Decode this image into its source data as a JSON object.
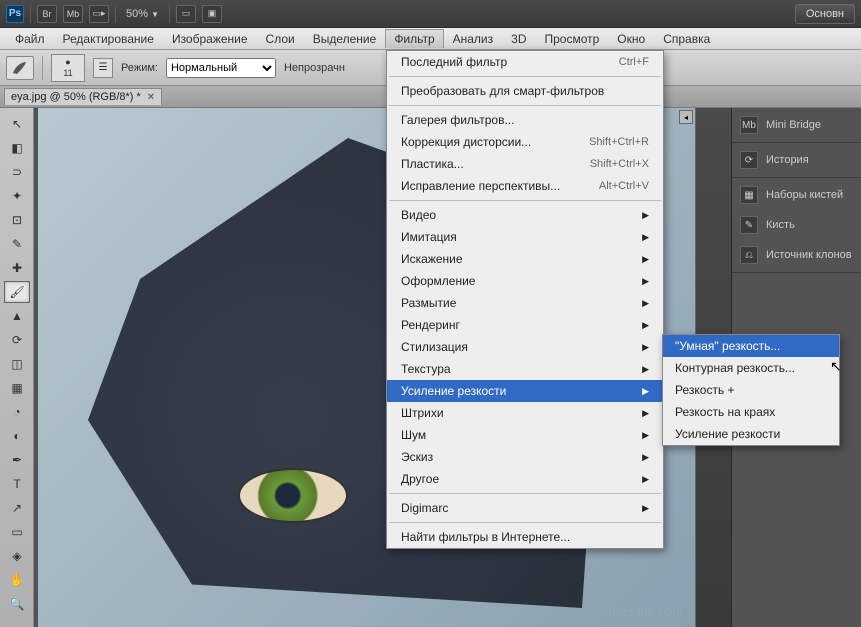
{
  "titlebar": {
    "ps": "Ps",
    "br": "Br",
    "mb": "Mb",
    "zoom": "50%",
    "essentials": "Основн"
  },
  "menubar": [
    "Файл",
    "Редактирование",
    "Изображение",
    "Слои",
    "Выделение",
    "Фильтр",
    "Анализ",
    "3D",
    "Просмотр",
    "Окно",
    "Справка"
  ],
  "menubar_open_index": 5,
  "options": {
    "mode_label": "Режим:",
    "mode_value": "Нормальный",
    "opacity_label": "Непрозрачн",
    "brush_size": "11"
  },
  "doc": {
    "title": "eya.jpg @ 50% (RGB/8*) *"
  },
  "tools": [
    "move",
    "marquee",
    "lasso",
    "wand",
    "crop",
    "eyedropper",
    "heal",
    "brush",
    "stamp",
    "history",
    "eraser",
    "gradient",
    "blur",
    "dodge",
    "pen",
    "type",
    "path",
    "shape",
    "3d",
    "hand",
    "zoom"
  ],
  "active_tool_index": 7,
  "panels": {
    "g1": [
      {
        "icon": "Mb",
        "label": "Mini Bridge"
      }
    ],
    "g2": [
      {
        "icon": "⟳",
        "label": "История"
      }
    ],
    "g3": [
      {
        "icon": "▦",
        "label": "Наборы кистей"
      },
      {
        "icon": "✎",
        "label": "Кисть"
      },
      {
        "icon": "⎌",
        "label": "Источник клонов"
      }
    ]
  },
  "dropdown": [
    {
      "t": "item",
      "label": "Последний фильтр",
      "shortcut": "Ctrl+F"
    },
    {
      "t": "sep"
    },
    {
      "t": "item",
      "label": "Преобразовать для смарт-фильтров"
    },
    {
      "t": "sep"
    },
    {
      "t": "item",
      "label": "Галерея фильтров..."
    },
    {
      "t": "item",
      "label": "Коррекция дисторсии...",
      "shortcut": "Shift+Ctrl+R"
    },
    {
      "t": "item",
      "label": "Пластика...",
      "shortcut": "Shift+Ctrl+X"
    },
    {
      "t": "item",
      "label": "Исправление перспективы...",
      "shortcut": "Alt+Ctrl+V"
    },
    {
      "t": "sep"
    },
    {
      "t": "sub",
      "label": "Видео"
    },
    {
      "t": "sub",
      "label": "Имитация"
    },
    {
      "t": "sub",
      "label": "Искажение"
    },
    {
      "t": "sub",
      "label": "Оформление"
    },
    {
      "t": "sub",
      "label": "Размытие"
    },
    {
      "t": "sub",
      "label": "Рендеринг"
    },
    {
      "t": "sub",
      "label": "Стилизация"
    },
    {
      "t": "sub",
      "label": "Текстура"
    },
    {
      "t": "sub",
      "label": "Усиление резкости",
      "hover": true
    },
    {
      "t": "sub",
      "label": "Штрихи"
    },
    {
      "t": "sub",
      "label": "Шум"
    },
    {
      "t": "sub",
      "label": "Эскиз"
    },
    {
      "t": "sub",
      "label": "Другое"
    },
    {
      "t": "sep"
    },
    {
      "t": "sub",
      "label": "Digimarc"
    },
    {
      "t": "sep"
    },
    {
      "t": "item",
      "label": "Найти фильтры в Интернете..."
    }
  ],
  "submenu": [
    {
      "label": "\"Умная\" резкость...",
      "hover": true
    },
    {
      "label": "Контурная резкость..."
    },
    {
      "label": "Резкость +"
    },
    {
      "label": "Резкость на краях"
    },
    {
      "label": "Усиление резкости"
    }
  ],
  "watermark": "user-life.com"
}
